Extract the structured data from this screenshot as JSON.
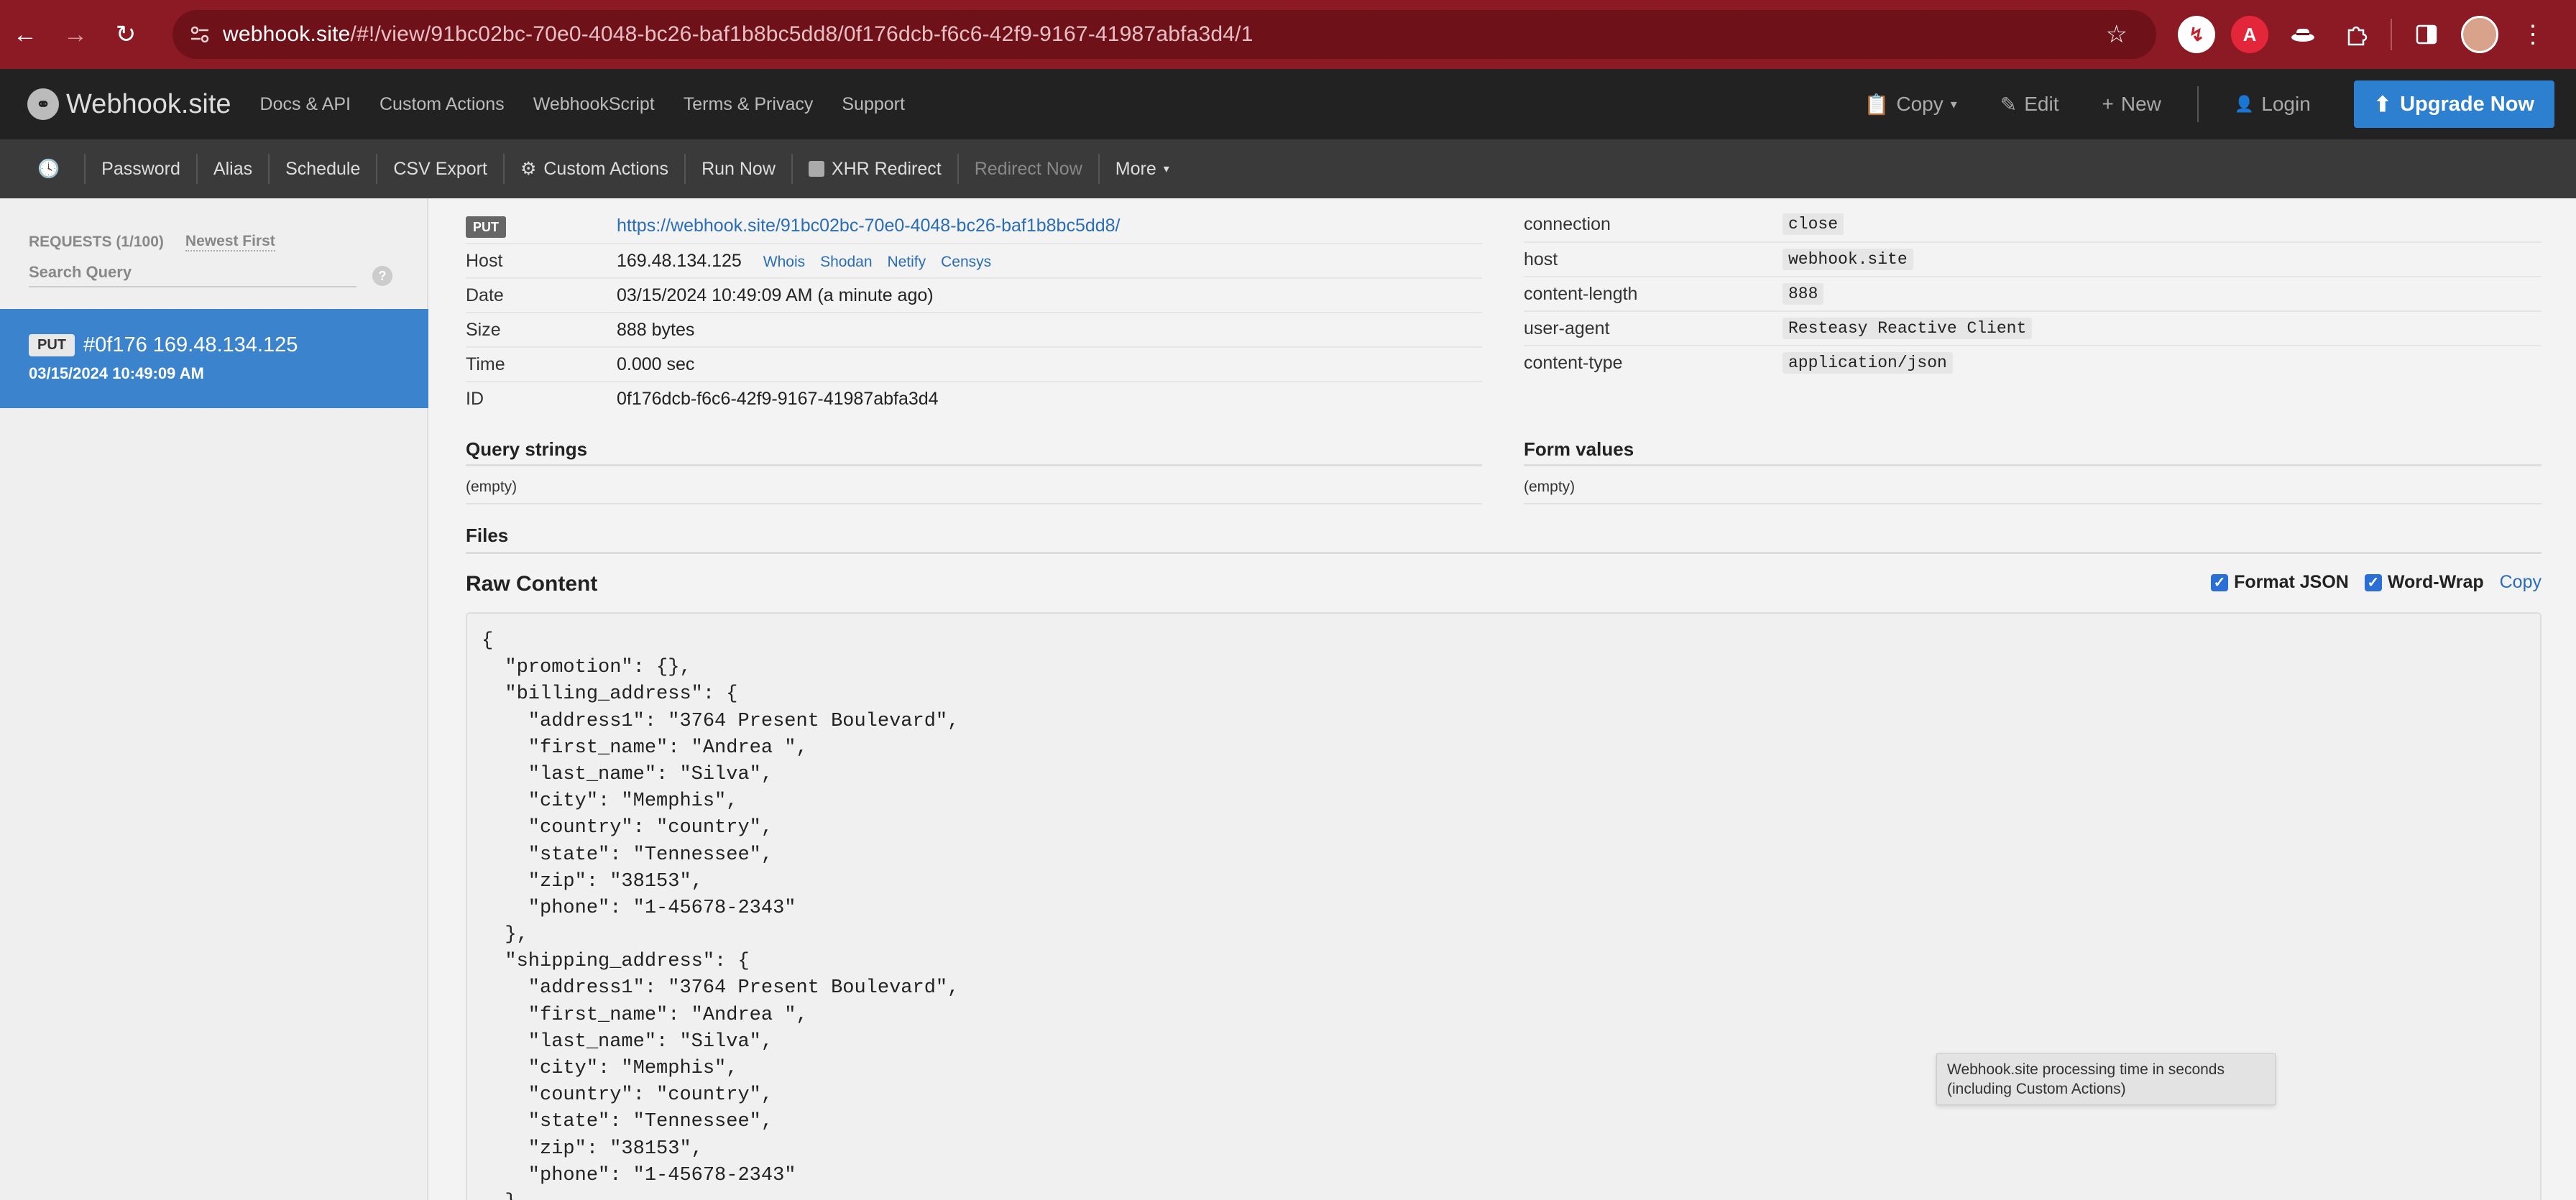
{
  "browser": {
    "url_host": "webhook.site",
    "url_path": "/#!/view/91bc02bc-70e0-4048-bc26-baf1b8bc5dd8/0f176dcb-f6c6-42f9-9167-41987abfa3d4/1",
    "icons": [
      "back-icon",
      "forward-icon",
      "reload-icon",
      "site-settings-icon",
      "bookmark-star-icon",
      "pdf-extension-icon",
      "a-extension-icon",
      "hat-extension-icon",
      "puzzle-extension-icon",
      "side-panel-icon",
      "profile-avatar",
      "menu-dots-icon"
    ]
  },
  "app_nav": {
    "brand": "Webhook.site",
    "links": [
      "Docs & API",
      "Custom Actions",
      "WebhookScript",
      "Terms & Privacy",
      "Support"
    ],
    "copy": "Copy",
    "edit": "Edit",
    "new": "New",
    "login": "Login",
    "upgrade": "Upgrade Now"
  },
  "toolbar": {
    "items": [
      "Password",
      "Alias",
      "Schedule",
      "CSV Export",
      "Custom Actions",
      "Run Now",
      "XHR Redirect",
      "Redirect Now",
      "More"
    ]
  },
  "sidebar": {
    "count": "REQUESTS (1/100)",
    "sort": "Newest First",
    "search_placeholder": "Search Query",
    "help": "?",
    "request": {
      "method": "PUT",
      "title": "#0f176 169.48.134.125",
      "date": "03/15/2024 10:49:09 AM"
    }
  },
  "details": {
    "method": "PUT",
    "url": "https://webhook.site/91bc02bc-70e0-4048-bc26-baf1b8bc5dd8/",
    "host_label": "Host",
    "host": "169.48.134.125",
    "host_links": [
      "Whois",
      "Shodan",
      "Netify",
      "Censys"
    ],
    "date_label": "Date",
    "date": "03/15/2024 10:49:09 AM (a minute ago)",
    "size_label": "Size",
    "size": "888 bytes",
    "time_label": "Time",
    "time": "0.000 sec",
    "id_label": "ID",
    "id": "0f176dcb-f6c6-42f9-9167-41987abfa3d4"
  },
  "headers": [
    {
      "key": "connection",
      "value": "close"
    },
    {
      "key": "host",
      "value": "webhook.site"
    },
    {
      "key": "content-length",
      "value": "888"
    },
    {
      "key": "user-agent",
      "value": "Resteasy Reactive Client"
    },
    {
      "key": "content-type",
      "value": "application/json"
    }
  ],
  "sections": {
    "query_strings": "Query strings",
    "query_empty": "(empty)",
    "form_values": "Form values",
    "form_empty": "(empty)",
    "files": "Files",
    "raw_content": "Raw Content",
    "format_json": "Format JSON",
    "word_wrap": "Word-Wrap",
    "copy": "Copy"
  },
  "raw_lines": [
    "{",
    "  \"promotion\": {},",
    "  \"billing_address\": {",
    "    \"address1\": \"3764 Present Boulevard\",",
    "    \"first_name\": \"Andrea \",",
    "    \"last_name\": \"Silva\",",
    "    \"city\": \"Memphis\",",
    "    \"country\": \"country\",",
    "    \"state\": \"Tennessee\",",
    "    \"zip\": \"38153\",",
    "    \"phone\": \"1-45678-2343\"",
    "  },",
    "  \"shipping_address\": {",
    "    \"address1\": \"3764 Present Boulevard\",",
    "    \"first_name\": \"Andrea \",",
    "    \"last_name\": \"Silva\",",
    "    \"city\": \"Memphis\",",
    "    \"country\": \"country\",",
    "    \"state\": \"Tennessee\",",
    "    \"zip\": \"38153\",",
    "    \"phone\": \"1-45678-2343\"",
    "  },"
  ],
  "tooltip": {
    "line1": "Webhook.site processing time in seconds",
    "line2": "(including Custom Actions)"
  }
}
